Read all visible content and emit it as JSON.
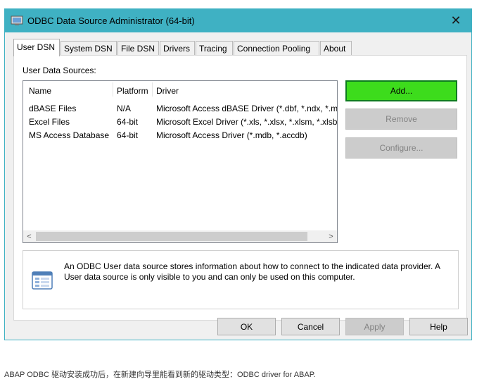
{
  "window": {
    "title": "ODBC Data Source Administrator (64-bit)",
    "close_glyph": "✕"
  },
  "tabs": [
    {
      "label": "User DSN"
    },
    {
      "label": "System DSN"
    },
    {
      "label": "File DSN"
    },
    {
      "label": "Drivers"
    },
    {
      "label": "Tracing"
    },
    {
      "label": "Connection Pooling"
    },
    {
      "label": "About"
    }
  ],
  "panel": {
    "list_label": "User Data Sources:",
    "columns": [
      "Name",
      "Platform",
      "Driver"
    ],
    "rows": [
      {
        "name": "dBASE Files",
        "platform": "N/A",
        "driver": "Microsoft Access dBASE Driver (*.dbf, *.ndx, *.m"
      },
      {
        "name": "Excel Files",
        "platform": "64-bit",
        "driver": "Microsoft Excel Driver (*.xls, *.xlsx, *.xlsm, *.xlsb)"
      },
      {
        "name": "MS Access Database",
        "platform": "64-bit",
        "driver": "Microsoft Access Driver (*.mdb, *.accdb)"
      }
    ],
    "scroll_left": "<",
    "scroll_right": ">",
    "buttons": {
      "add": "Add...",
      "remove": "Remove",
      "configure": "Configure..."
    },
    "info_text": "An ODBC User data source stores information about how to connect to the indicated data provider.  A User data source is only visible to you and can only be used on this computer."
  },
  "footer_buttons": {
    "ok": "OK",
    "cancel": "Cancel",
    "apply": "Apply",
    "help": "Help"
  },
  "caption": "ABAP ODBC 驱动安装成功后，在新建向导里能看到新的驱动类型：ODBC driver for ABAP.",
  "colors": {
    "titlebar": "#3fb1c3",
    "add_button": "#3ddc1c",
    "add_border": "#0e7c1f"
  }
}
